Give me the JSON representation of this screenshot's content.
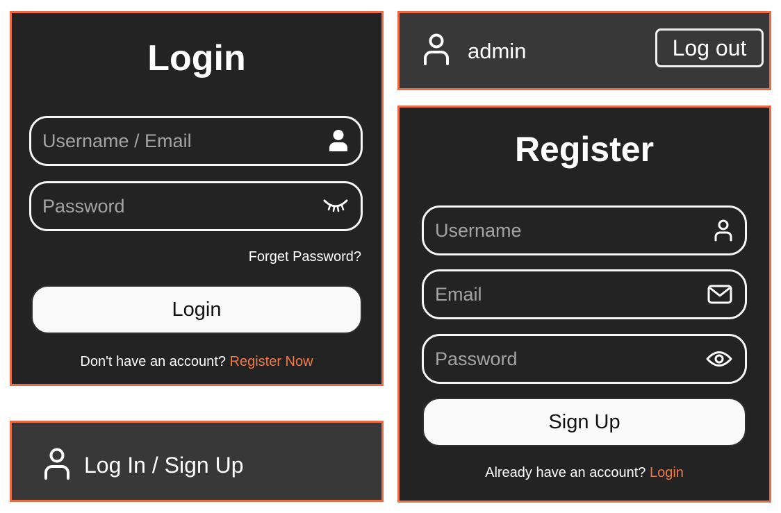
{
  "login_panel": {
    "title": "Login",
    "username_placeholder": "Username / Email",
    "password_placeholder": "Password",
    "forgot_label": "Forget Password?",
    "button_label": "Login",
    "footer_text": "Don't have an account?",
    "footer_link": "Register Now",
    "icons": {
      "username": "user-solid-icon",
      "password": "eye-closed-icon"
    }
  },
  "login_signup_bar": {
    "label": "Log In / Sign Up",
    "icon": "user-icon"
  },
  "user_bar": {
    "username": "admin",
    "logout_label": "Log out",
    "icon": "user-icon"
  },
  "register_panel": {
    "title": "Register",
    "username_placeholder": "Username",
    "email_placeholder": "Email",
    "password_placeholder": "Password",
    "button_label": "Sign Up",
    "footer_text": "Already have an account?",
    "footer_link": "Login",
    "icons": {
      "username": "user-icon",
      "email": "mail-icon",
      "password": "eye-open-icon"
    }
  },
  "colors": {
    "accent": "#ec6a46",
    "link": "#ef7a48",
    "panel_bg": "#232323",
    "bar_bg": "#383838",
    "button_bg": "#fafafa",
    "placeholder": "#a4a4a4"
  }
}
